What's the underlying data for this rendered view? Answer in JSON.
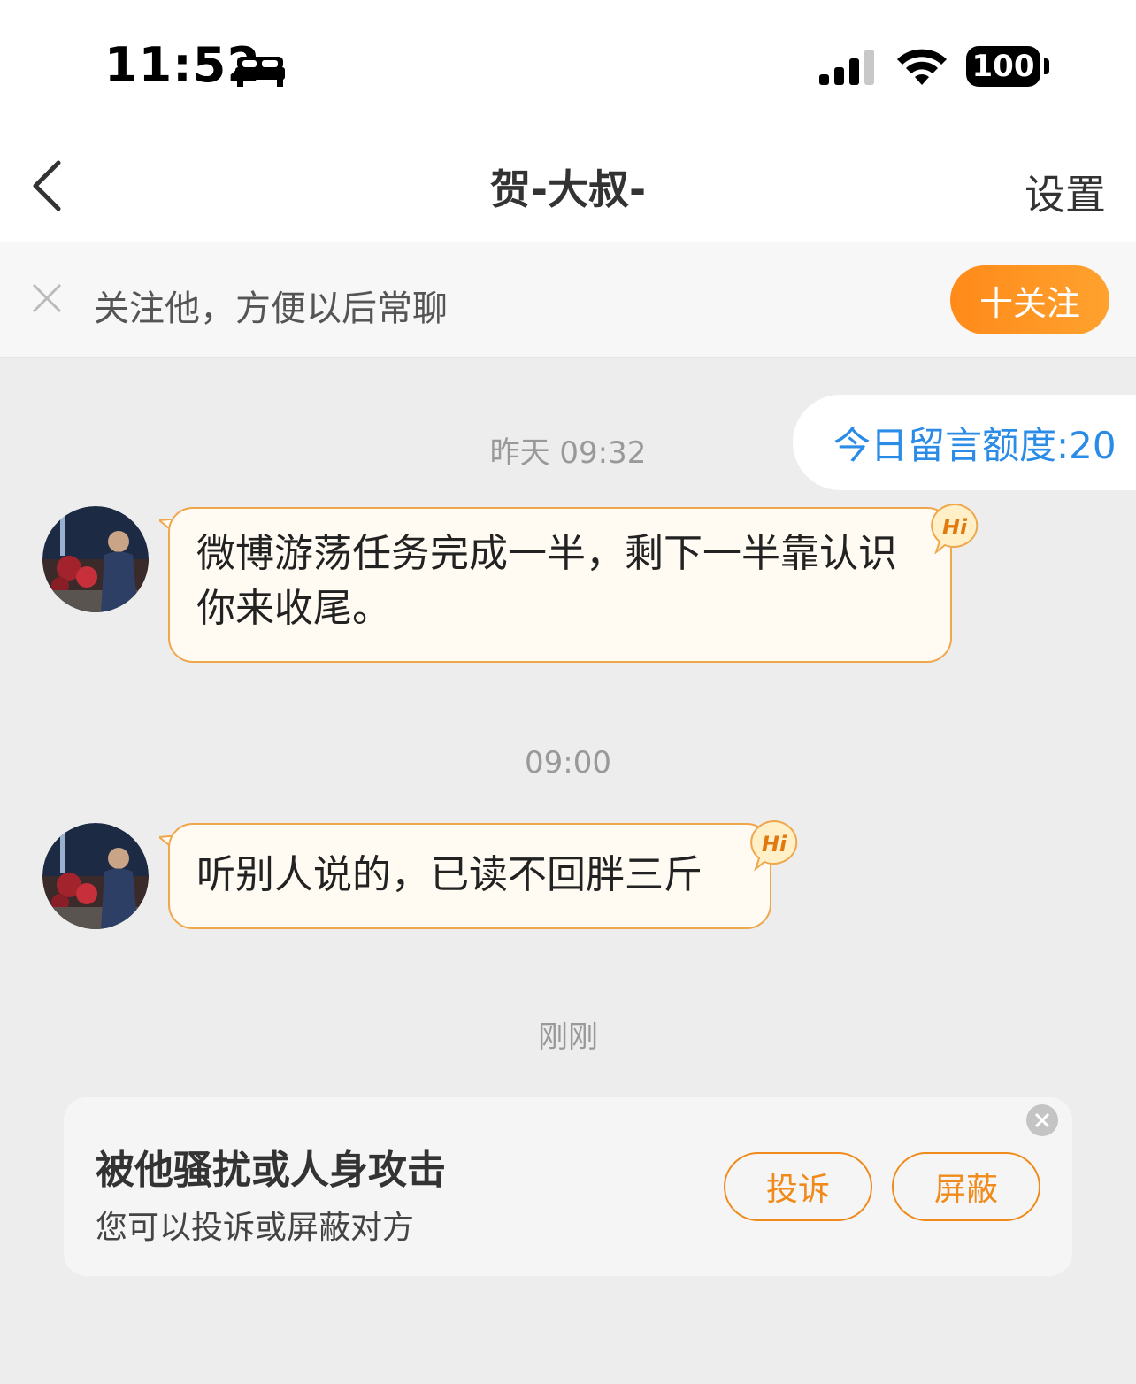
{
  "status": {
    "time": "11:52",
    "battery": "100"
  },
  "nav": {
    "title": "贺-大叔-",
    "settings_label": "设置"
  },
  "follow_bar": {
    "text": "关注他，方便以后常聊",
    "button_label": "十关注"
  },
  "quota": {
    "label": "今日留言额度:20"
  },
  "messages": [
    {
      "timestamp": "昨天 09:32",
      "text": "微博游荡任务完成一半，剩下一半靠认识你来收尾。",
      "badge": "Hi"
    },
    {
      "timestamp": "09:00",
      "text": "听别人说的，已读不回胖三斤",
      "badge": "Hi"
    }
  ],
  "recent_timestamp": "刚刚",
  "report_card": {
    "title": "被他骚扰或人身攻击",
    "subtitle": "您可以投诉或屏蔽对方",
    "complain_label": "投诉",
    "block_label": "屏蔽"
  },
  "colors": {
    "accent_orange": "#ff8a1a",
    "bubble_border": "#f0a64a",
    "bubble_bg": "#fffbf3",
    "quota_blue": "#2b8ce8",
    "chat_bg": "#ededed"
  },
  "icons": [
    "bed-icon",
    "cellular-signal-icon",
    "wifi-icon",
    "battery-icon",
    "back-chevron-icon",
    "close-icon",
    "hi-badge-icon",
    "avatar"
  ]
}
